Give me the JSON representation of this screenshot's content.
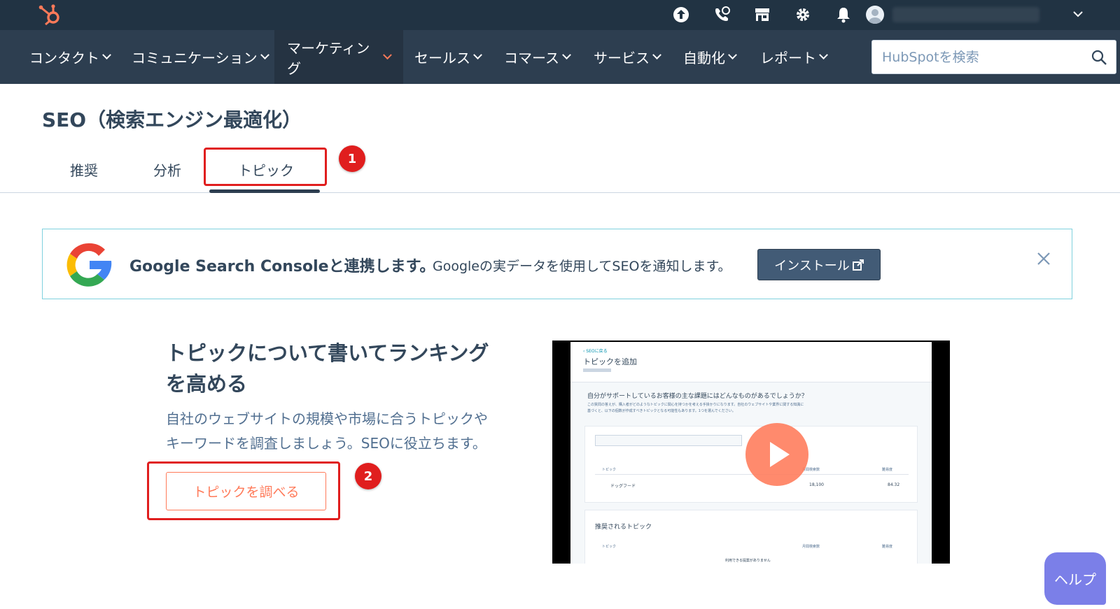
{
  "topbar": {
    "icons": [
      "upgrade-icon",
      "calling-icon",
      "marketplace-icon",
      "settings-icon",
      "notifications-icon"
    ],
    "account_chevron": "chevron-down-icon"
  },
  "nav": {
    "items": [
      {
        "label": "コンタクト"
      },
      {
        "label": "コミュニケーション"
      },
      {
        "label": "マーケティング",
        "active": true
      },
      {
        "label": "セールス"
      },
      {
        "label": "コマース"
      },
      {
        "label": "サービス"
      },
      {
        "label": "自動化"
      },
      {
        "label": "レポート"
      }
    ],
    "search_placeholder": "HubSpotを検索"
  },
  "page": {
    "title": "SEO（検索エンジン最適化）",
    "tabs": [
      {
        "label": "推奨"
      },
      {
        "label": "分析"
      },
      {
        "label": "トピック",
        "active": true
      }
    ]
  },
  "annotations": {
    "badge_1": "1",
    "badge_2": "2"
  },
  "banner": {
    "title": "Google Search Consoleと連携します。",
    "description": "Googleの実データを使用してSEOを通知します。",
    "install_label": "インストール"
  },
  "promo": {
    "heading": "トピックについて書いてランキングを高める",
    "description": "自社のウェブサイトの規模や市場に合うトピックやキーワードを調査しましょう。SEOに役立ちます。",
    "button_label": "トピックを調べる"
  },
  "video": {
    "breadcrumb": "‹ SEOに戻る",
    "title": "トピックを追加",
    "question": "自分がサポートしているお客様の主な課題にはどんなものがあるでしょうか？",
    "hint_line1": "この質問の答えが、購入者がどのようなトピックに関心を持つかを考える手掛かりになります。自社のウェブサイトや業界に関する知識に",
    "hint_line2": "基づくと、以下の個数が作成すべきトピックとなる可能性もあります。1つを選んでください。",
    "col_topic": "トピック",
    "col_volume": "月間検索数",
    "col_difficulty": "難易度",
    "row_topic": "ドッグフード",
    "row_volume": "18,100",
    "row_difficulty": "84.32",
    "recommended_title": "推奨されるトピック",
    "empty_text": "利用できる提案がありません"
  },
  "help": {
    "label": "ヘルプ"
  },
  "colors": {
    "topbar": "#213343",
    "navbar": "#2d3e50",
    "accent": "#ff7a59",
    "annotation": "#e01e1e",
    "install": "#425b76",
    "help": "#7b7fe8"
  }
}
